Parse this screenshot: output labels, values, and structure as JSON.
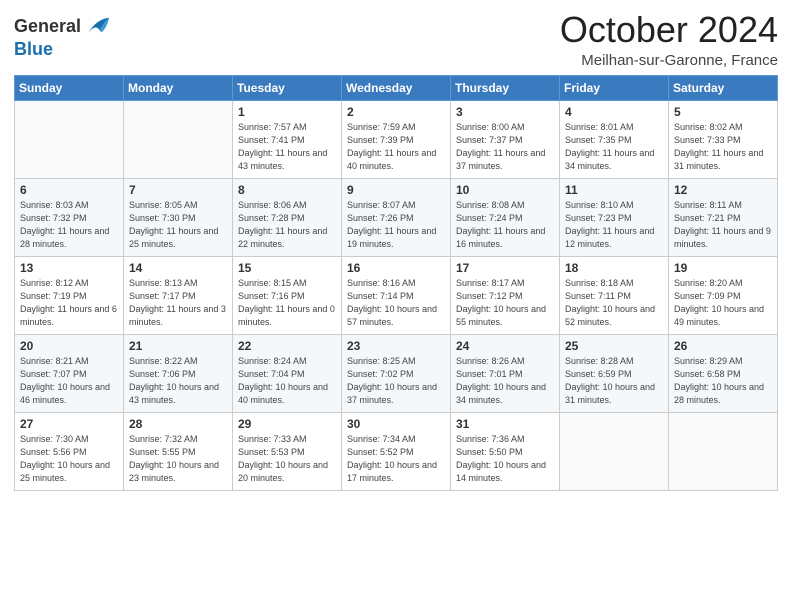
{
  "header": {
    "logo_general": "General",
    "logo_blue": "Blue",
    "month_title": "October 2024",
    "location": "Meilhan-sur-Garonne, France"
  },
  "days_of_week": [
    "Sunday",
    "Monday",
    "Tuesday",
    "Wednesday",
    "Thursday",
    "Friday",
    "Saturday"
  ],
  "weeks": [
    [
      {
        "day": "",
        "detail": ""
      },
      {
        "day": "",
        "detail": ""
      },
      {
        "day": "1",
        "detail": "Sunrise: 7:57 AM\nSunset: 7:41 PM\nDaylight: 11 hours and 43 minutes."
      },
      {
        "day": "2",
        "detail": "Sunrise: 7:59 AM\nSunset: 7:39 PM\nDaylight: 11 hours and 40 minutes."
      },
      {
        "day": "3",
        "detail": "Sunrise: 8:00 AM\nSunset: 7:37 PM\nDaylight: 11 hours and 37 minutes."
      },
      {
        "day": "4",
        "detail": "Sunrise: 8:01 AM\nSunset: 7:35 PM\nDaylight: 11 hours and 34 minutes."
      },
      {
        "day": "5",
        "detail": "Sunrise: 8:02 AM\nSunset: 7:33 PM\nDaylight: 11 hours and 31 minutes."
      }
    ],
    [
      {
        "day": "6",
        "detail": "Sunrise: 8:03 AM\nSunset: 7:32 PM\nDaylight: 11 hours and 28 minutes."
      },
      {
        "day": "7",
        "detail": "Sunrise: 8:05 AM\nSunset: 7:30 PM\nDaylight: 11 hours and 25 minutes."
      },
      {
        "day": "8",
        "detail": "Sunrise: 8:06 AM\nSunset: 7:28 PM\nDaylight: 11 hours and 22 minutes."
      },
      {
        "day": "9",
        "detail": "Sunrise: 8:07 AM\nSunset: 7:26 PM\nDaylight: 11 hours and 19 minutes."
      },
      {
        "day": "10",
        "detail": "Sunrise: 8:08 AM\nSunset: 7:24 PM\nDaylight: 11 hours and 16 minutes."
      },
      {
        "day": "11",
        "detail": "Sunrise: 8:10 AM\nSunset: 7:23 PM\nDaylight: 11 hours and 12 minutes."
      },
      {
        "day": "12",
        "detail": "Sunrise: 8:11 AM\nSunset: 7:21 PM\nDaylight: 11 hours and 9 minutes."
      }
    ],
    [
      {
        "day": "13",
        "detail": "Sunrise: 8:12 AM\nSunset: 7:19 PM\nDaylight: 11 hours and 6 minutes."
      },
      {
        "day": "14",
        "detail": "Sunrise: 8:13 AM\nSunset: 7:17 PM\nDaylight: 11 hours and 3 minutes."
      },
      {
        "day": "15",
        "detail": "Sunrise: 8:15 AM\nSunset: 7:16 PM\nDaylight: 11 hours and 0 minutes."
      },
      {
        "day": "16",
        "detail": "Sunrise: 8:16 AM\nSunset: 7:14 PM\nDaylight: 10 hours and 57 minutes."
      },
      {
        "day": "17",
        "detail": "Sunrise: 8:17 AM\nSunset: 7:12 PM\nDaylight: 10 hours and 55 minutes."
      },
      {
        "day": "18",
        "detail": "Sunrise: 8:18 AM\nSunset: 7:11 PM\nDaylight: 10 hours and 52 minutes."
      },
      {
        "day": "19",
        "detail": "Sunrise: 8:20 AM\nSunset: 7:09 PM\nDaylight: 10 hours and 49 minutes."
      }
    ],
    [
      {
        "day": "20",
        "detail": "Sunrise: 8:21 AM\nSunset: 7:07 PM\nDaylight: 10 hours and 46 minutes."
      },
      {
        "day": "21",
        "detail": "Sunrise: 8:22 AM\nSunset: 7:06 PM\nDaylight: 10 hours and 43 minutes."
      },
      {
        "day": "22",
        "detail": "Sunrise: 8:24 AM\nSunset: 7:04 PM\nDaylight: 10 hours and 40 minutes."
      },
      {
        "day": "23",
        "detail": "Sunrise: 8:25 AM\nSunset: 7:02 PM\nDaylight: 10 hours and 37 minutes."
      },
      {
        "day": "24",
        "detail": "Sunrise: 8:26 AM\nSunset: 7:01 PM\nDaylight: 10 hours and 34 minutes."
      },
      {
        "day": "25",
        "detail": "Sunrise: 8:28 AM\nSunset: 6:59 PM\nDaylight: 10 hours and 31 minutes."
      },
      {
        "day": "26",
        "detail": "Sunrise: 8:29 AM\nSunset: 6:58 PM\nDaylight: 10 hours and 28 minutes."
      }
    ],
    [
      {
        "day": "27",
        "detail": "Sunrise: 7:30 AM\nSunset: 5:56 PM\nDaylight: 10 hours and 25 minutes."
      },
      {
        "day": "28",
        "detail": "Sunrise: 7:32 AM\nSunset: 5:55 PM\nDaylight: 10 hours and 23 minutes."
      },
      {
        "day": "29",
        "detail": "Sunrise: 7:33 AM\nSunset: 5:53 PM\nDaylight: 10 hours and 20 minutes."
      },
      {
        "day": "30",
        "detail": "Sunrise: 7:34 AM\nSunset: 5:52 PM\nDaylight: 10 hours and 17 minutes."
      },
      {
        "day": "31",
        "detail": "Sunrise: 7:36 AM\nSunset: 5:50 PM\nDaylight: 10 hours and 14 minutes."
      },
      {
        "day": "",
        "detail": ""
      },
      {
        "day": "",
        "detail": ""
      }
    ]
  ]
}
